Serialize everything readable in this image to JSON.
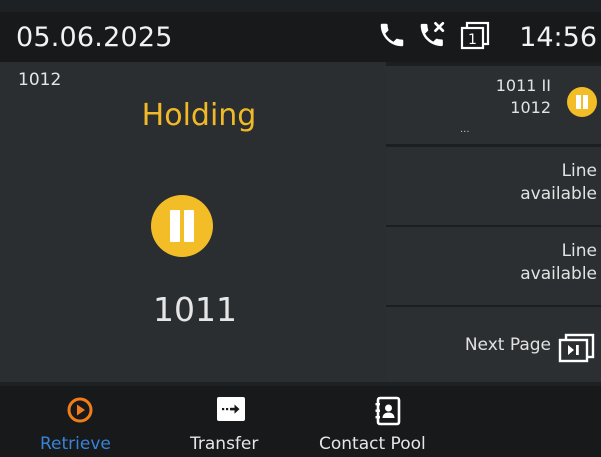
{
  "status_bar": {
    "date": "05.06.2025",
    "time": "14:56",
    "icons": [
      "phone-icon",
      "missed-call-icon",
      "account-1-icon"
    ],
    "account_badge": "1"
  },
  "active_call": {
    "account": "1012",
    "state": "Holding",
    "remote_number": "1011",
    "accent_color": "#f3bd28",
    "state_color": "#f1b928"
  },
  "line_keys": [
    {
      "line1": "1011 II",
      "line2": "1012",
      "extra": "...",
      "icon": "hold-icon"
    },
    {
      "line1": "Line",
      "line2": "available"
    },
    {
      "line1": "Line",
      "line2": "available"
    }
  ],
  "next_page": {
    "label": "Next Page",
    "icon": "next-page-icon"
  },
  "softkeys": [
    {
      "label": "Retrieve",
      "icon": "retrieve-icon",
      "color": "#3b82d6",
      "icon_color": "#f07d1a"
    },
    {
      "label": "Transfer",
      "icon": "transfer-icon"
    },
    {
      "label": "Contact Pool",
      "icon": "contact-book-icon"
    }
  ]
}
